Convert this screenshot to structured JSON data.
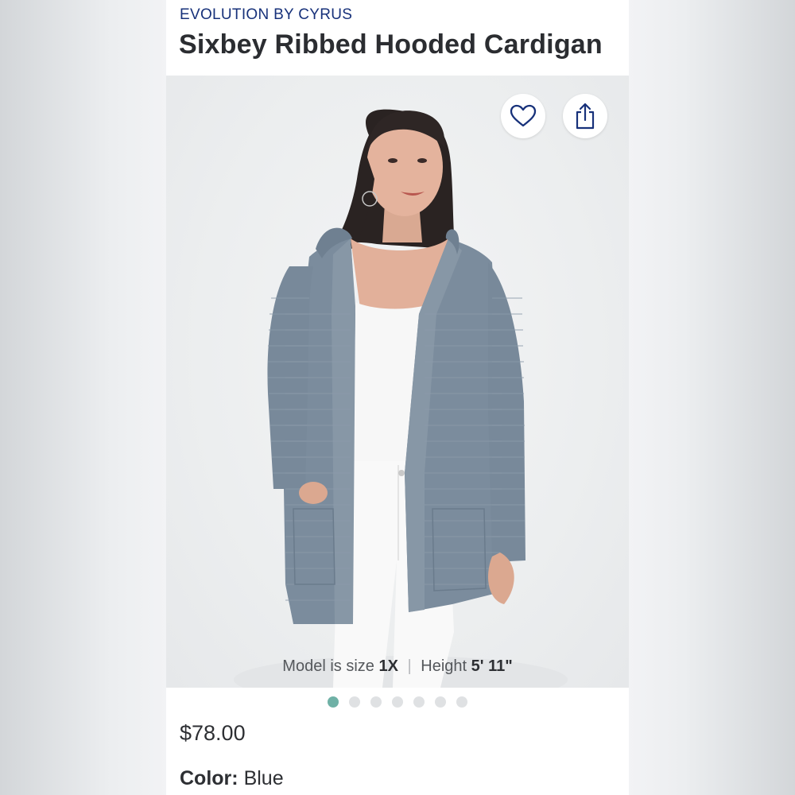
{
  "product": {
    "brand": "EVOLUTION BY CYRUS",
    "title": "Sixbey Ribbed Hooded Cardigan",
    "price": "$78.00",
    "color_label": "Color:",
    "color_value": "Blue"
  },
  "image": {
    "alt": "Model wearing a blue ribbed hooded cardigan over a white top and white jeans",
    "model_size_prefix": "Model is size",
    "model_size": "1X",
    "separator": "|",
    "height_prefix": "Height",
    "height_value": "5' 11\""
  },
  "carousel": {
    "total": 7,
    "active_index": 0
  },
  "icons": {
    "favorite": "heart-outline-icon",
    "share": "share-icon"
  },
  "colors": {
    "brand": "#17317a",
    "accent_dot": "#6fb1a6",
    "cardigan": "#7b8c9d",
    "text": "#2d2f33"
  }
}
